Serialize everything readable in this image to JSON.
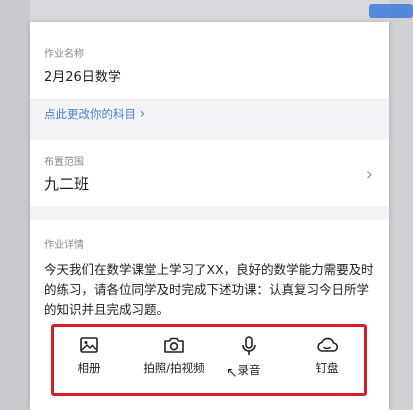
{
  "form": {
    "name_label": "作业名称",
    "name_value": "2月26日数学",
    "change_subject_link": "点此更改你的科目",
    "change_subject_chevron": "›",
    "range_label": "布置范围",
    "range_value": "九二班",
    "range_chevron": "›",
    "detail_label": "作业详情",
    "detail_text": "今天我们在数学课堂上学习了XX，良好的数学能力需要及时的练习，请各位同学及时完成下述功课：认真复习今日所学的知识并且完成习题。"
  },
  "toolbar": {
    "items": [
      {
        "label": "相册",
        "icon": "image-icon"
      },
      {
        "label": "拍照/拍视频",
        "icon": "camera-icon"
      },
      {
        "label": "录音",
        "icon": "microphone-icon"
      },
      {
        "label": "钉盘",
        "icon": "cloud-icon"
      }
    ],
    "highlight_color": "#d4202a"
  },
  "colors": {
    "link": "#4a7fc9",
    "label": "#8a8a8a",
    "section_gap": "#f3f4f6"
  }
}
